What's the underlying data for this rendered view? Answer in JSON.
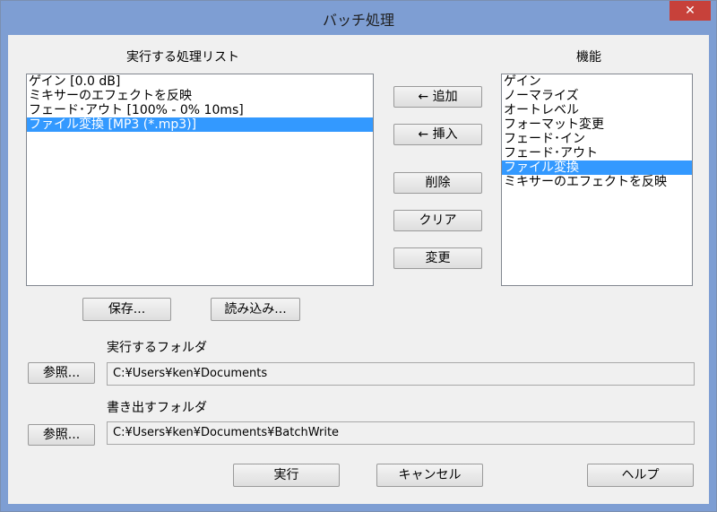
{
  "window": {
    "title": "バッチ処理",
    "close_glyph": "✕"
  },
  "process_list": {
    "label": "実行する処理リスト",
    "items": [
      {
        "text": "ゲイン [0.0 dB]",
        "selected": false
      },
      {
        "text": "ミキサーのエフェクトを反映",
        "selected": false
      },
      {
        "text": "フェード･アウト [100% - 0% 10ms]",
        "selected": false
      },
      {
        "text": "ファイル変換 [MP3 (*.mp3)]",
        "selected": true
      }
    ]
  },
  "functions": {
    "label": "機能",
    "items": [
      {
        "text": "ゲイン",
        "selected": false
      },
      {
        "text": "ノーマライズ",
        "selected": false
      },
      {
        "text": "オートレベル",
        "selected": false
      },
      {
        "text": "フォーマット変更",
        "selected": false
      },
      {
        "text": "フェード･イン",
        "selected": false
      },
      {
        "text": "フェード･アウト",
        "selected": false
      },
      {
        "text": "ファイル変換",
        "selected": true
      },
      {
        "text": "ミキサーのエフェクトを反映",
        "selected": false
      }
    ]
  },
  "buttons": {
    "add": "← 追加",
    "insert": "← 挿入",
    "delete": "削除",
    "clear": "クリア",
    "change": "変更",
    "save": "保存...",
    "load": "読み込み...",
    "browse": "参照...",
    "run": "実行",
    "cancel": "キャンセル",
    "help": "ヘルプ"
  },
  "exec_folder": {
    "label": "実行するフォルダ",
    "value": "C:¥Users¥ken¥Documents"
  },
  "write_folder": {
    "label": "書き出すフォルダ",
    "value": "C:¥Users¥ken¥Documents¥BatchWrite"
  },
  "colors": {
    "titlebar": "#7e9ed3",
    "selection": "#3399ff",
    "close": "#c7413a"
  }
}
